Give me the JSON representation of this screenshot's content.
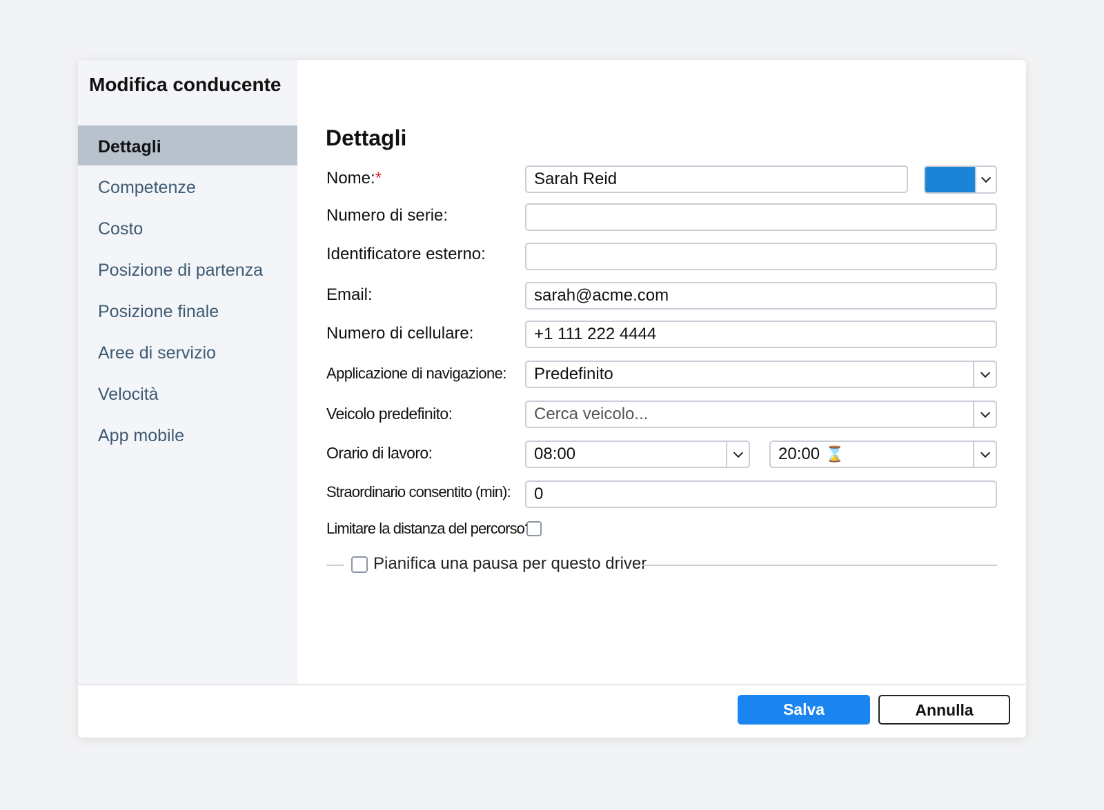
{
  "dialog": {
    "title": "Modifica conducente"
  },
  "sidebar": {
    "items": [
      {
        "label": "Dettagli",
        "active": true
      },
      {
        "label": "Competenze"
      },
      {
        "label": "Costo"
      },
      {
        "label": "Posizione di partenza"
      },
      {
        "label": "Posizione finale"
      },
      {
        "label": "Aree di servizio"
      },
      {
        "label": "Velocità"
      },
      {
        "label": "App mobile"
      }
    ]
  },
  "form": {
    "section_title": "Dettagli",
    "name": {
      "label": "Nome:",
      "required_mark": "*",
      "value": "Sarah Reid",
      "color": "#1a85d6"
    },
    "serial": {
      "label": "Numero di serie:",
      "value": ""
    },
    "external_id": {
      "label": "Identificatore esterno:",
      "value": ""
    },
    "email": {
      "label": "Email:",
      "value": "sarah@acme.com"
    },
    "mobile": {
      "label": "Numero di cellulare:",
      "value": "+1 111 222 4444"
    },
    "nav_app": {
      "label": "Applicazione di navigazione:",
      "value": "Predefinito"
    },
    "default_vehicle": {
      "label": "Veicolo predefinito:",
      "placeholder": "Cerca veicolo..."
    },
    "work_hours": {
      "label": "Orario di lavoro:",
      "start": "08:00",
      "end": "20:00",
      "end_icon": "hourglass-icon"
    },
    "overtime": {
      "label": "Straordinario consentito (min):",
      "value": "0"
    },
    "limit_distance": {
      "label": "Limitare la distanza del percorso?",
      "checked": false
    },
    "break": {
      "label": "Pianifica una pausa per questo driver",
      "checked": false
    }
  },
  "footer": {
    "save_label": "Salva",
    "cancel_label": "Annulla"
  }
}
